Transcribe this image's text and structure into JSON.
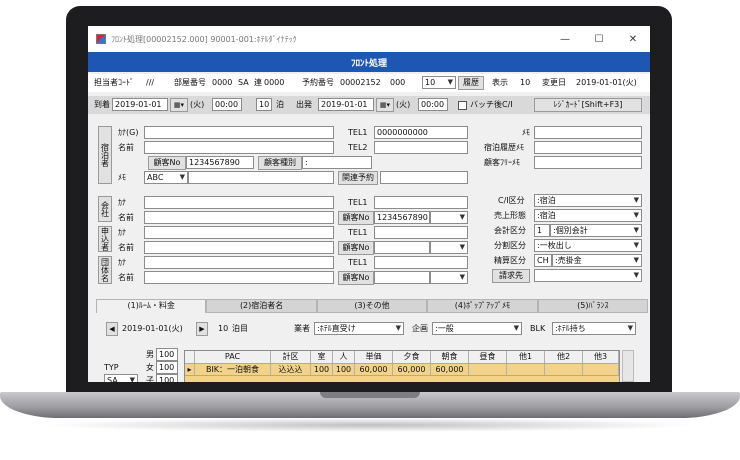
{
  "window": {
    "title": "ﾌﾛﾝﾄ処理[00002152.000]  90001-001:ﾎﾃﾙﾀﾞｲﾅﾃｯｸ",
    "min": "—",
    "max": "☐",
    "close": "✕"
  },
  "header": {
    "title": "ﾌﾛﾝﾄ処理"
  },
  "row1": {
    "tantosha_label": "担当者ｺｰﾄﾞ",
    "tantosha_value": "///",
    "room_label": "部屋番号",
    "room_value": "0000",
    "sa_label": "SA",
    "ren_label": "連",
    "ren_value": "0000",
    "yoyaku_label": "予約番号",
    "yoyaku_value": "00002152",
    "yoyaku_sub": "000",
    "select_value": "10",
    "history_button": "履歴",
    "display_label": "表示",
    "display_value": "10",
    "change_label": "変更日",
    "change_value": "2019-01-01(火)"
  },
  "row2": {
    "arrival_label": "到着",
    "arrival_date": "2019-01-01",
    "arrival_dow": "(火)",
    "arrival_time": "00:00",
    "nights_value": "10",
    "nights_label": "泊",
    "depart_label": "出発",
    "depart_date": "2019-01-01",
    "depart_dow": "(火)",
    "depart_time": "00:00",
    "batch_label": "バッチ後C/I",
    "receipt_button": "ﾚｼﾞｶｰﾄﾞ[Shift+F3]"
  },
  "guest": {
    "tab_label": "宿泊者",
    "kana_label": "ｶﾅ(G)",
    "name_label": "名前",
    "tel1_label": "TEL1",
    "tel1_value": "0000000000",
    "tel2_label": "TEL2",
    "memo_label": "ﾒﾓ",
    "history_memo_label": "宿泊履歴ﾒﾓ",
    "free_memo_label": "顧客ﾌﾘｰﾒﾓ",
    "customer_no_button": "顧客No",
    "customer_no_value": "1234567890",
    "customer_type_button": "顧客種別",
    "customer_type_value": ":",
    "memo2_label": "ﾒﾓ",
    "memo2_value": "ABC",
    "related_button": "関連予約"
  },
  "company": {
    "tab_label": "会社",
    "kana_label": "ｶﾅ",
    "name_label": "名前",
    "tel1_label": "TEL1",
    "customer_no_button": "顧客No",
    "customer_no_value": "1234567890"
  },
  "applicant": {
    "tab_label": "申込者",
    "kana_label": "ｶﾅ",
    "name_label": "名前",
    "tel1_label": "TEL1",
    "customer_no_button": "顧客No"
  },
  "group": {
    "tab_label": "団体名",
    "kana_label": "ｶﾅ",
    "name_label": "名前",
    "tel1_label": "TEL1",
    "customer_no_button": "顧客No"
  },
  "classification": {
    "ci_label": "C/I区分",
    "ci_value": ":宿泊",
    "sales_label": "売上形態",
    "sales_value": ":宿泊",
    "account_label": "会計区分",
    "account_no": "1",
    "account_value": ":個別会計",
    "split_label": "分割区分",
    "split_value": ":一枚出し",
    "settle_label": "精算区分",
    "settle_code": "CH",
    "settle_value": ":売掛金",
    "bill_button": "請求先"
  },
  "tabs": [
    {
      "label": "(1)ﾙｰﾑ・料金"
    },
    {
      "label": "(2)宿泊者名"
    },
    {
      "label": "(3)その他"
    },
    {
      "label": "(4)ﾎﾟｯﾌﾟｱｯﾌﾟﾒﾓ"
    },
    {
      "label": "(5)ﾊﾞﾗﾝｽ"
    }
  ],
  "roomrate": {
    "prev": "◀",
    "date": "2019-01-01(火)",
    "next": "▶",
    "nights_value": "10",
    "nights_label": "泊目",
    "agent_label": "業者",
    "agent_value": ":ﾎﾃﾙ直受け",
    "plan_label": "企画",
    "plan_value": ":一般",
    "blk_label": "BLK",
    "blk_value": ":ﾎﾃﾙ持ち",
    "typ_label": "TYP",
    "typ_value": "SA",
    "male_label": "男",
    "male_value": "100",
    "female_label": "女",
    "female_value": "100",
    "child_label": "子",
    "child_value": "100"
  },
  "grid": {
    "headers": [
      "",
      "PAC",
      "計区",
      "室",
      "人",
      "単価",
      "夕食",
      "朝食",
      "昼食",
      "他1",
      "他2",
      "他3"
    ],
    "row": [
      "▸",
      "BIK：一泊朝食",
      "込込込",
      "100",
      "100",
      "60,000",
      "60,000",
      "60,000",
      "",
      "",
      "",
      ""
    ]
  }
}
